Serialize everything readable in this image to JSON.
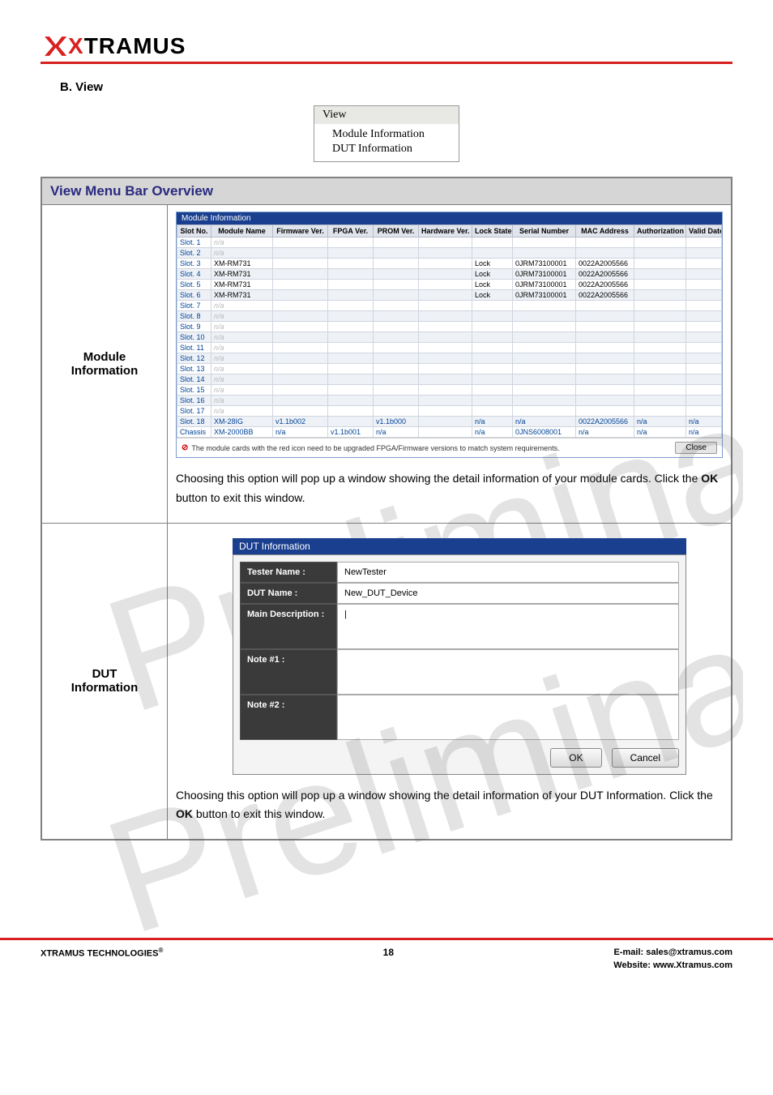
{
  "logo": {
    "prefix": "X",
    "rest": "TRAMUS"
  },
  "section_heading": "B. View",
  "menu": {
    "title": "View",
    "items": [
      "Module Information",
      "DUT Information"
    ]
  },
  "overview": {
    "title": "View Menu Bar Overview",
    "module_info_label": "Module\nInformation",
    "dut_info_label": "DUT\nInformation",
    "module_desc_pre": "Choosing this option will pop up a window showing the detail information of your module cards. Click the ",
    "module_desc_bold": "OK",
    "module_desc_post": " button to exit this window.",
    "dut_desc_pre": "Choosing this option will pop up a window showing the detail information of your DUT Information. Click the ",
    "dut_desc_bold": "OK",
    "dut_desc_post": " button to exit this window."
  },
  "module_window": {
    "title": "Module Information",
    "columns": [
      "Slot No.",
      "Module Name",
      "Firmware Ver.",
      "FPGA Ver.",
      "PROM Ver.",
      "Hardware Ver.",
      "Lock State",
      "Serial Number",
      "MAC Address",
      "Authorization",
      "Valid Date/Times"
    ],
    "rows": [
      {
        "slot": "Slot. 1",
        "name": "n/a",
        "na": true
      },
      {
        "slot": "Slot. 2",
        "name": "n/a",
        "na": true
      },
      {
        "slot": "Slot. 3",
        "name": "XM-RM731",
        "lock": "Lock",
        "serial": "0JRM73100001",
        "mac": "0022A2005566"
      },
      {
        "slot": "Slot. 4",
        "name": "XM-RM731",
        "lock": "Lock",
        "serial": "0JRM73100001",
        "mac": "0022A2005566"
      },
      {
        "slot": "Slot. 5",
        "name": "XM-RM731",
        "lock": "Lock",
        "serial": "0JRM73100001",
        "mac": "0022A2005566"
      },
      {
        "slot": "Slot. 6",
        "name": "XM-RM731",
        "lock": "Lock",
        "serial": "0JRM73100001",
        "mac": "0022A2005566"
      },
      {
        "slot": "Slot. 7",
        "name": "n/a",
        "na": true
      },
      {
        "slot": "Slot. 8",
        "name": "n/a",
        "na": true
      },
      {
        "slot": "Slot. 9",
        "name": "n/a",
        "na": true
      },
      {
        "slot": "Slot. 10",
        "name": "n/a",
        "na": true
      },
      {
        "slot": "Slot. 11",
        "name": "n/a",
        "na": true
      },
      {
        "slot": "Slot. 12",
        "name": "n/a",
        "na": true
      },
      {
        "slot": "Slot. 13",
        "name": "n/a",
        "na": true
      },
      {
        "slot": "Slot. 14",
        "name": "n/a",
        "na": true
      },
      {
        "slot": "Slot. 15",
        "name": "n/a",
        "na": true
      },
      {
        "slot": "Slot. 16",
        "name": "n/a",
        "na": true
      },
      {
        "slot": "Slot. 17",
        "name": "n/a",
        "na": true
      },
      {
        "slot": "Slot. 18",
        "name": "XM-28IG",
        "fw": "v1.1b002",
        "prom": "v1.1b000",
        "lock": "n/a",
        "serial": "n/a",
        "mac": "0022A2005566",
        "auth": "n/a",
        "valid": "n/a",
        "blue": true
      },
      {
        "slot": "Chassis",
        "name": "XM-2000BB",
        "fw": "n/a",
        "fpga": "v1.1b001",
        "prom": "n/a",
        "lock": "n/a",
        "serial": "0JNS6008001",
        "mac": "n/a",
        "auth": "n/a",
        "valid": "n/a",
        "blue": true
      }
    ],
    "footer_text": "The module cards with the red icon need to be upgraded FPGA/Firmware versions to match system requirements.",
    "close_label": "Close"
  },
  "dut_window": {
    "title": "DUT Information",
    "fields": [
      {
        "label": "Tester Name :",
        "value": "NewTester",
        "tall": false
      },
      {
        "label": "DUT Name :",
        "value": "New_DUT_Device",
        "tall": false
      },
      {
        "label": "Main Description :",
        "value": "|",
        "tall": true
      },
      {
        "label": "Note #1 :",
        "value": "",
        "tall": true
      },
      {
        "label": "Note #2 :",
        "value": "",
        "tall": true
      }
    ],
    "ok_label": "OK",
    "cancel_label": "Cancel"
  },
  "footer": {
    "left": "XTRAMUS TECHNOLOGIES",
    "page": "18",
    "email_label": "E-mail: ",
    "email": "sales@xtramus.com",
    "web_label": "Website:  ",
    "web": "www.Xtramus.com"
  },
  "watermark": "Preliminary"
}
